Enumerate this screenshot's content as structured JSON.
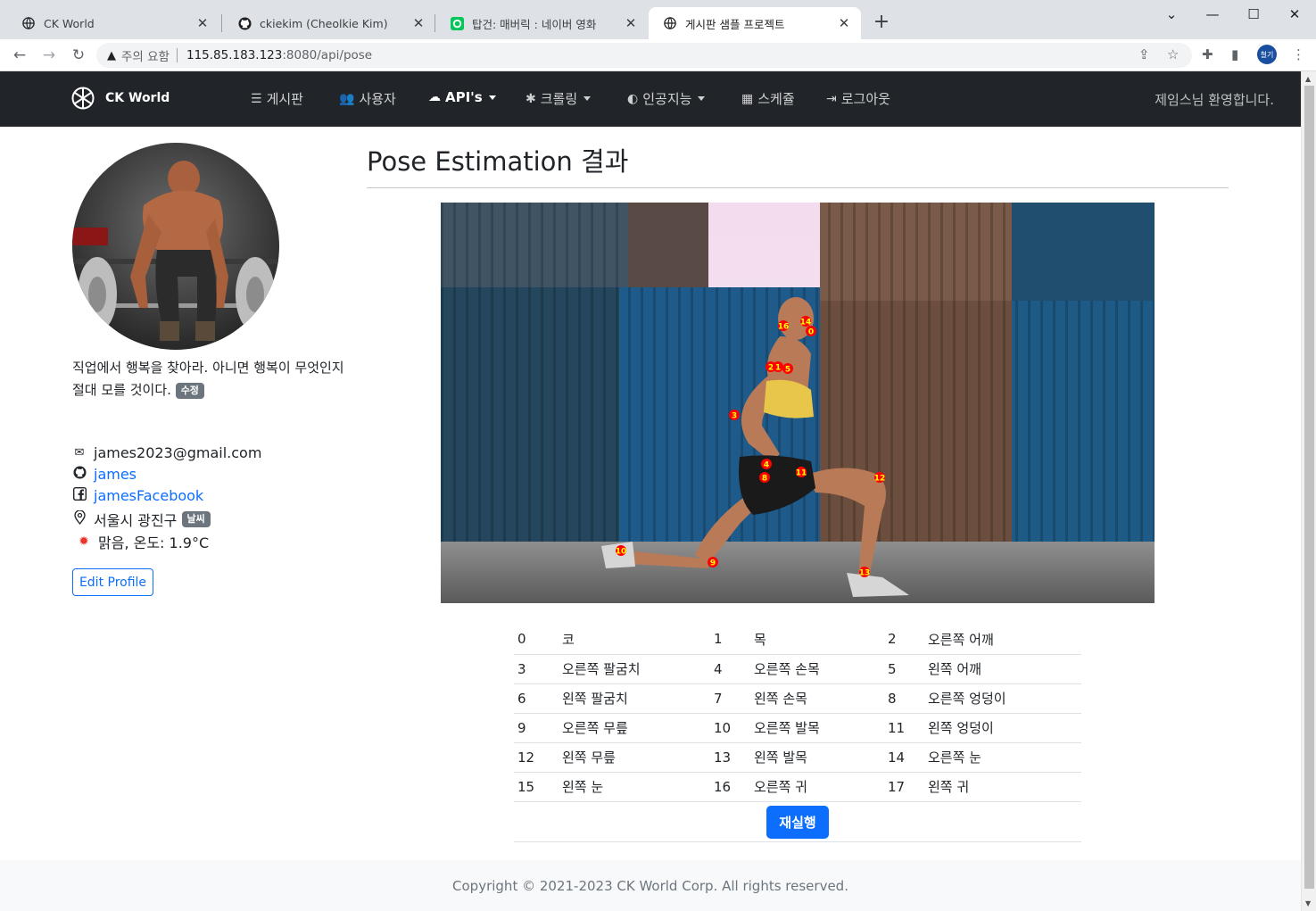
{
  "browser": {
    "tabs": [
      {
        "title": "CK World",
        "icon": "globe-icon"
      },
      {
        "title": "ckiekim (Cheolkie Kim)",
        "icon": "github-icon"
      },
      {
        "title": "탑건: 매버릭 : 네이버 영화",
        "icon": "naver-movie-icon"
      },
      {
        "title": "게시판 샘플 프로젝트",
        "icon": "globe-icon"
      }
    ],
    "new_tab": "+",
    "security_warning": "주의 요함",
    "url_host": "115.85.183.123",
    "url_path": ":8080/api/pose",
    "profile_initials": "철기"
  },
  "navbar": {
    "brand": "CK World",
    "items": [
      {
        "label": "게시판",
        "icon": "board-icon",
        "dropdown": false
      },
      {
        "label": "사용자",
        "icon": "users-icon",
        "dropdown": false
      },
      {
        "label": "API's",
        "icon": "cloud-icon",
        "dropdown": true
      },
      {
        "label": "크롤링",
        "icon": "bug-icon",
        "dropdown": true
      },
      {
        "label": "인공지능",
        "icon": "brain-icon",
        "dropdown": true
      },
      {
        "label": "스케쥴",
        "icon": "calendar-icon",
        "dropdown": false
      },
      {
        "label": "로그아웃",
        "icon": "logout-icon",
        "dropdown": false
      }
    ],
    "welcome": "제임스님 환영합니다."
  },
  "profile": {
    "motto": "직업에서 행복을 찾아라. 아니면 행복이 무엇인지 절대 모를 것이다.",
    "motto_badge": "수정",
    "email": "james2023@gmail.com",
    "github": "james",
    "facebook": "jamesFacebook",
    "location": "서울시 광진구",
    "weather_badge": "날씨",
    "weather": "맑음, 온도: 1.9°C",
    "edit_button": "Edit Profile"
  },
  "main": {
    "title": "Pose Estimation 결과",
    "keypoints": [
      [
        {
          "n": "0",
          "name": "코"
        },
        {
          "n": "1",
          "name": "목"
        },
        {
          "n": "2",
          "name": "오른쪽 어깨"
        }
      ],
      [
        {
          "n": "3",
          "name": "오른쪽 팔굼치"
        },
        {
          "n": "4",
          "name": "오른쪽 손목"
        },
        {
          "n": "5",
          "name": "왼쪽 어깨"
        }
      ],
      [
        {
          "n": "6",
          "name": "왼쪽 팔굼치"
        },
        {
          "n": "7",
          "name": "왼쪽 손목"
        },
        {
          "n": "8",
          "name": "오른쪽 엉덩이"
        }
      ],
      [
        {
          "n": "9",
          "name": "오른쪽 무릎"
        },
        {
          "n": "10",
          "name": "오른쪽 발목"
        },
        {
          "n": "11",
          "name": "왼쪽 엉덩이"
        }
      ],
      [
        {
          "n": "12",
          "name": "왼쪽 무릎"
        },
        {
          "n": "13",
          "name": "왼쪽 발목"
        },
        {
          "n": "14",
          "name": "오른쪽 눈"
        }
      ],
      [
        {
          "n": "15",
          "name": "왼쪽 눈"
        },
        {
          "n": "16",
          "name": "오른쪽 귀"
        },
        {
          "n": "17",
          "name": "왼쪽 귀"
        }
      ]
    ],
    "image_markers": [
      "16",
      "14",
      "0",
      "2",
      "1",
      "5",
      "3",
      "4",
      "8",
      "11",
      "12",
      "10",
      "9",
      "13"
    ],
    "rerun_button": "재실행"
  },
  "footer": {
    "text": "Copyright © 2021-2023 CK World Corp. All rights reserved."
  },
  "colors": {
    "navbar_bg": "#212529",
    "primary": "#0d6efd",
    "badge": "#6c757d",
    "marker_fill": "#ff0000",
    "marker_text": "#ffff00"
  }
}
